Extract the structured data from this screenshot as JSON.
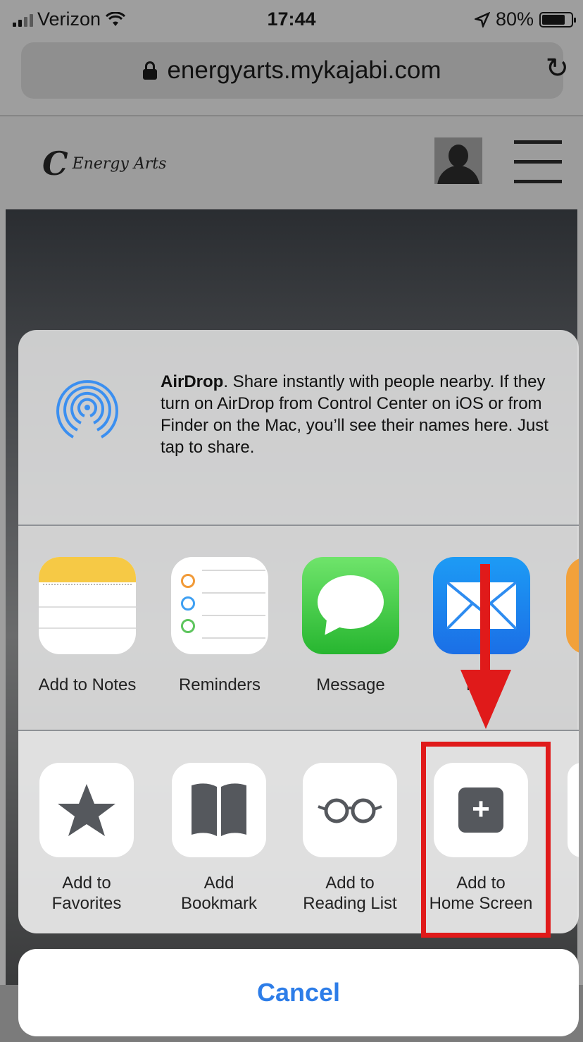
{
  "status_bar": {
    "carrier": "Verizon",
    "time": "17:44",
    "battery": "80%",
    "battery_level": 0.8
  },
  "browser": {
    "url": "energyarts.mykajabi.com"
  },
  "site": {
    "logo_text": "Energy Arts"
  },
  "airdrop": {
    "title": "AirDrop",
    "description": ". Share instantly with people nearby. If they turn on AirDrop from Control Center on iOS or from Finder on the Mac, you’ll see their names here. Just tap to share."
  },
  "share_apps": [
    {
      "label": "Add to Notes",
      "icon": "notes-icon"
    },
    {
      "label": "Reminders",
      "icon": "reminders-icon"
    },
    {
      "label": "Message",
      "icon": "message-icon"
    },
    {
      "label": "Mail",
      "icon": "mail-icon"
    }
  ],
  "actions": [
    {
      "line1": "Add to",
      "line2": "Favorites",
      "icon": "star-icon"
    },
    {
      "line1": "Add",
      "line2": "Bookmark",
      "icon": "book-icon"
    },
    {
      "line1": "Add to",
      "line2": "Reading List",
      "icon": "glasses-icon"
    },
    {
      "line1": "Add to",
      "line2": "Home Screen",
      "icon": "plus-square-icon"
    }
  ],
  "cancel_label": "Cancel",
  "colors": {
    "annotation_red": "#e01a1a",
    "cancel_blue": "#2d7de8"
  }
}
